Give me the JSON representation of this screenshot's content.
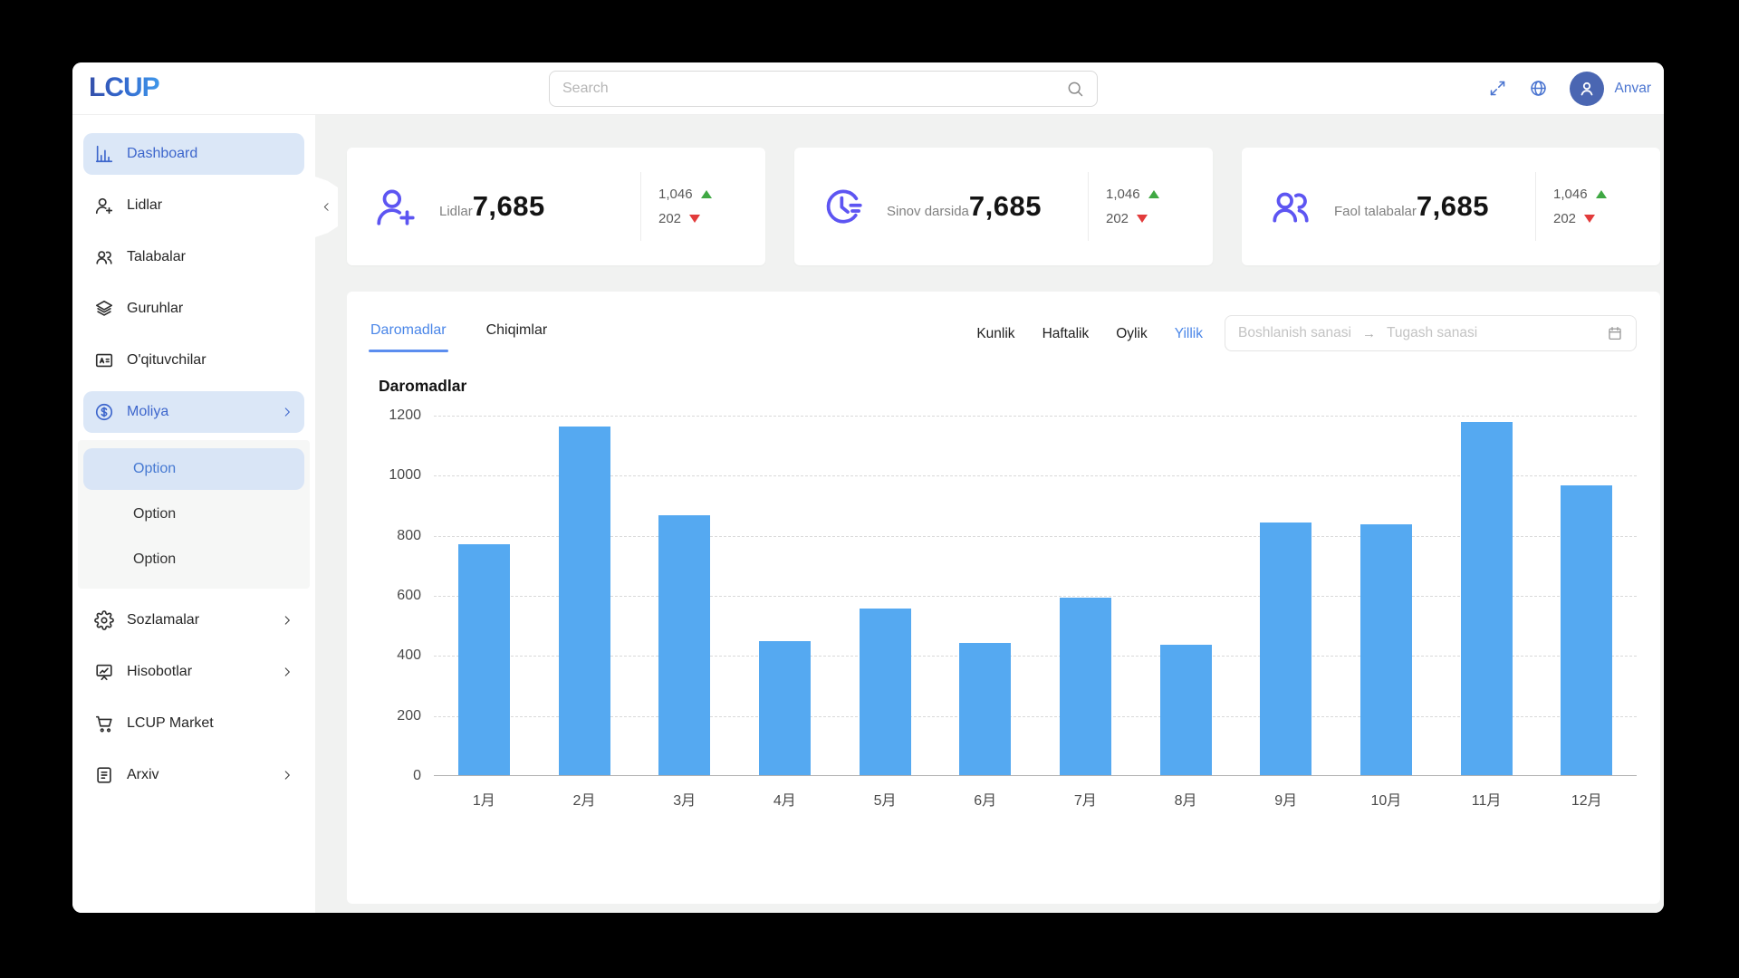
{
  "header": {
    "logo": "LCUP",
    "search_placeholder": "Search",
    "user_name": "Anvar"
  },
  "sidebar": {
    "items": [
      {
        "label": "Dashboard",
        "icon": "dashboard",
        "active": true
      },
      {
        "label": "Lidlar",
        "icon": "user-add"
      },
      {
        "label": "Talabalar",
        "icon": "users"
      },
      {
        "label": "Guruhlar",
        "icon": "layers"
      },
      {
        "label": "O'qituvchilar",
        "icon": "id-card"
      },
      {
        "label": "Moliya",
        "icon": "dollar",
        "active": true,
        "chevron": true,
        "submenu": [
          "Option",
          "Option",
          "Option"
        ],
        "submenu_active_index": 0
      },
      {
        "label": "Sozlamalar",
        "icon": "gear",
        "chevron": true
      },
      {
        "label": "Hisobotlar",
        "icon": "report",
        "chevron": true
      },
      {
        "label": "LCUP Market",
        "icon": "cart"
      },
      {
        "label": "Arxiv",
        "icon": "archive",
        "chevron": true
      }
    ]
  },
  "stat_cards": [
    {
      "label": "Lidlar",
      "value": "7,685",
      "up": "1,046",
      "down": "202",
      "icon": "user-add"
    },
    {
      "label": "Sinov darsida",
      "value": "7,685",
      "up": "1,046",
      "down": "202",
      "icon": "clock"
    },
    {
      "label": "Faol talabalar",
      "value": "7,685",
      "up": "1,046",
      "down": "202",
      "icon": "users"
    }
  ],
  "chart_section": {
    "tabs": [
      {
        "label": "Daromadlar",
        "active": true
      },
      {
        "label": "Chiqimlar",
        "active": false
      }
    ],
    "filters": [
      {
        "label": "Kunlik",
        "active": false
      },
      {
        "label": "Haftalik",
        "active": false
      },
      {
        "label": "Oylik",
        "active": false
      },
      {
        "label": "Yillik",
        "active": true
      }
    ],
    "date_range": {
      "start_placeholder": "Boshlanish sanasi",
      "separator": "→",
      "end_placeholder": "Tugash sanasi"
    },
    "title": "Daromadlar"
  },
  "chart_data": {
    "type": "bar",
    "title": "Daromadlar",
    "categories": [
      "1月",
      "2月",
      "3月",
      "4月",
      "5月",
      "6月",
      "7月",
      "8月",
      "9月",
      "10月",
      "11月",
      "12月"
    ],
    "values": [
      770,
      1160,
      865,
      445,
      555,
      440,
      590,
      435,
      840,
      835,
      1175,
      965
    ],
    "ylim": [
      0,
      1200
    ],
    "yticks": [
      0,
      200,
      400,
      600,
      800,
      1000,
      1200
    ],
    "bar_color": "#55a9f1",
    "grid": true,
    "legend": false
  },
  "colors": {
    "accent_blue": "#4a86e8",
    "sidebar_active_blue": "#3d66cc",
    "icon_purple": "#5d55f2",
    "up_green": "#3fa843",
    "down_red": "#e23b3b",
    "bar_blue": "#55a9f1"
  }
}
